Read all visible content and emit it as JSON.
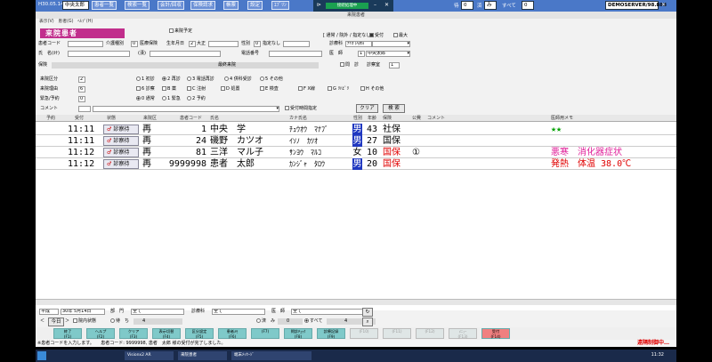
{
  "topbar": {
    "era_date": "H30.05.14",
    "department": "中央太郎",
    "menus": [
      "患者一覧",
      "検索一覧",
      "会計/回収",
      "保険請求",
      "帳票",
      "設定",
      "ｴﾌﾞﾘﾝ"
    ],
    "wait_label": "待",
    "wait_value": "0",
    "done_label": "済",
    "done_value": "み",
    "total_label": "すべて",
    "total_value": "0",
    "server": "DEMOSERVER/98.888"
  },
  "popup": {
    "status": "接続処理中"
  },
  "window": {
    "title": "来院患者",
    "menu": "表示(V)　患者(G)　ﾍﾙﾌﾟ(H)"
  },
  "header": {
    "mode_title": "来院患者",
    "reservation_label": "来院予定",
    "filter_text": "[ 通常 / 院外 / 指定なし ]",
    "accepted_label": "受付",
    "max_label": "最大"
  },
  "form": {
    "patient_code_label": "患者コード",
    "care_type_label": "介護種別",
    "care_type_value": "0",
    "medical_insurance_label": "医療保険",
    "birthdate_label": "生年月日",
    "era_value": "2",
    "era_name": "大正",
    "gender_label": "性別",
    "gender_value": "0",
    "gender_text": "指定なし",
    "department_label": "診療科",
    "department_value": "ﾅｲｶ",
    "department_name": "内科",
    "name_label": "氏　名(ｶﾅ)",
    "kanji_label": "(漢)",
    "phone_label": "電話番号",
    "doctor_label": "医　師",
    "doctor_value": "1",
    "doctor_name": "中央太郎",
    "insurance_label": "保険",
    "last_visit_label": "最終来院",
    "question_label": "問　診",
    "consult_room_label": "診察室",
    "consult_room_value": "1",
    "visit_type_label": "来院区分",
    "visit_type_value": "2",
    "visit_options": [
      "1 初診",
      "2 再診",
      "3 電話再診",
      "4 併科受診",
      "5 その他"
    ],
    "reason_label": "来院理由",
    "reason_value": "6",
    "reason_options": [
      "6 診察",
      "B 薬",
      "C 注射",
      "D 処置",
      "E 検査",
      "F X線",
      "G ﾘﾊﾋﾞﾘ",
      "H その他"
    ],
    "urgent_label": "緊急/予約",
    "urgent_value": "0",
    "urgent_options": [
      "0 通常",
      "1 緊急",
      "2 予約"
    ],
    "comment_label": "コメント",
    "time_spec_label": "受付時間指定",
    "clear_button": "クリア",
    "search_button": "検 索"
  },
  "table": {
    "headers": [
      "予約",
      "受付",
      "状態",
      "来院区",
      "患者コード",
      "氏名",
      "カナ氏名",
      "性別",
      "年齢",
      "保険",
      "公費",
      "コメント",
      "医師用メモ"
    ],
    "rows": [
      {
        "time": "11:11",
        "status": "診察待",
        "visit": "再",
        "code": "1",
        "name": "中央　学",
        "kana": "ﾁｭｳｵｳ　ﾏﾅﾌﾞ",
        "sex": "男",
        "age": "43",
        "insurance": "社保",
        "public": "",
        "memo": "★★",
        "memo_color": "#00a000",
        "ins_color": "#000000"
      },
      {
        "time": "11:11",
        "status": "診察待",
        "visit": "再",
        "code": "24",
        "name": "磯野　カツオ",
        "kana": "ｲｿﾉ　ｶﾂｵ",
        "sex": "男",
        "age": "27",
        "insurance": "国保",
        "public": "",
        "memo": "",
        "memo_color": "#000000",
        "ins_color": "#000000"
      },
      {
        "time": "11:12",
        "status": "診察待",
        "visit": "再",
        "code": "81",
        "name": "三洋　マル子",
        "kana": "ｻﾝﾖｳ　ﾏﾙｺ",
        "sex": "女",
        "age": "10",
        "insurance": "国保",
        "public": "①",
        "memo": "悪寒　消化器症状",
        "memo_color": "#e0209a",
        "ins_color": "#e00000"
      },
      {
        "time": "11:12",
        "status": "診察待",
        "visit": "再",
        "code": "9999998",
        "name": "患者　太郎",
        "kana": "ｶﾝｼﾞｬ　ﾀﾛｳ",
        "sex": "男",
        "age": "20",
        "insurance": "国保",
        "public": "",
        "memo": "発熱　体温 38.0℃",
        "memo_color": "#e00000",
        "ins_color": "#e00000"
      }
    ]
  },
  "bottom": {
    "era": "平成",
    "date_text": "30年 5月14日",
    "dept_label": "部　門",
    "dept_value": "全て",
    "shinryo_label": "診療科",
    "shinryo_value": "全て",
    "doctor_label": "医　師",
    "doctor_value": "全て",
    "today_button": "今日",
    "in_hospital_label": "院内状態",
    "wait_label": "待　ち",
    "wait_count": "4",
    "done_label": "済　み",
    "done_count": "0",
    "all_label": "すべて",
    "all_count": "4"
  },
  "fkeys": [
    {
      "label": "終了\n(F1)",
      "state": "on"
    },
    {
      "label": "ヘルプ\n(F2)",
      "state": "on"
    },
    {
      "label": "クリア\n(F3)",
      "state": "on"
    },
    {
      "label": "表示切替\n(F4)",
      "state": "on"
    },
    {
      "label": "区分設定\n(F5)",
      "state": "on"
    },
    {
      "label": "患者ﾒﾓ\n(F6)",
      "state": "on"
    },
    {
      "label": "(F7)",
      "state": "on"
    },
    {
      "label": "問診ﾁｪｯｸ\n(F8)",
      "state": "on"
    },
    {
      "label": "診療記録\n(F9)",
      "state": "on"
    },
    {
      "label": "(F10)",
      "state": "dis"
    },
    {
      "label": "(F11)",
      "state": "dis"
    },
    {
      "label": "(F12)",
      "state": "dis"
    },
    {
      "label": "ﾒﾆｭｰ\n(F13)",
      "state": "dis"
    },
    {
      "label": "受付\n(F14)",
      "state": "red"
    }
  ],
  "status": {
    "message": "※患者コードを入力します。　　患者コード: 9999998, 患者　太郎 様の受付が完了しました。",
    "right": "遠隔制御中…"
  },
  "taskbar": {
    "items": [
      "Visionx2 AR",
      "来院患者",
      "端末ﾒｯｾｰｼﾞ"
    ],
    "clock": "11:32"
  }
}
